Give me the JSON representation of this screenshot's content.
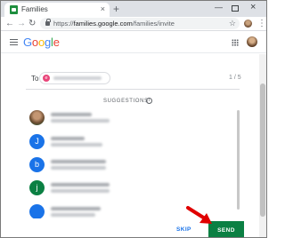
{
  "browser": {
    "tab_title": "Families",
    "url_prefix": "https://",
    "url_main": "families.google.com",
    "url_path": "/families/invite",
    "new_tab_glyph": "+",
    "close_tab_glyph": "×"
  },
  "header": {
    "logo": [
      "G",
      "o",
      "o",
      "g",
      "l",
      "e"
    ],
    "logo_colors": [
      "#4285f4",
      "#ea4335",
      "#fbbc05",
      "#4285f4",
      "#34a853",
      "#ea4335"
    ]
  },
  "invite": {
    "to_label": "To",
    "chip_initial": "e",
    "counter": "1 / 5"
  },
  "suggestions": {
    "label": "SUGGESTIONS",
    "contacts": [
      {
        "initial": "",
        "color": "photo"
      },
      {
        "initial": "J",
        "color": "#1a73e8"
      },
      {
        "initial": "b",
        "color": "#1a73e8"
      },
      {
        "initial": "j",
        "color": "#0b8043"
      },
      {
        "initial": "",
        "color": "#1a73e8"
      }
    ]
  },
  "actions": {
    "skip_label": "SKIP",
    "send_label": "SEND"
  },
  "colors": {
    "send": "#0b8043",
    "skip": "#1a73e8",
    "annotation_arrow": "#e00000"
  }
}
